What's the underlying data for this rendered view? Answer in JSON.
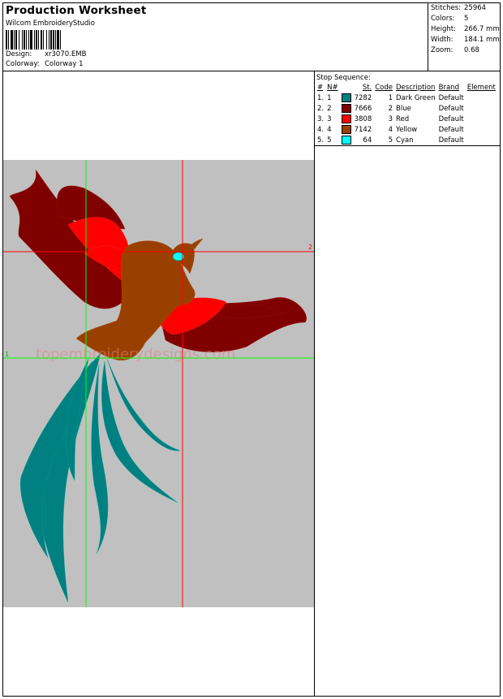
{
  "header": {
    "title": "Production Worksheet",
    "subtitle": "Wilcom EmbroideryStudio",
    "design_label": "Design:",
    "design_value": "xr3070.EMB",
    "colorway_label": "Colorway:",
    "colorway_value": "Colorway 1"
  },
  "stats": [
    {
      "label": "Stitches:",
      "value": "25964"
    },
    {
      "label": "Colors:",
      "value": "5"
    },
    {
      "label": "Height:",
      "value": "266.7 mm"
    },
    {
      "label": "Width:",
      "value": "184.1 mm"
    },
    {
      "label": "Zoom:",
      "value": "0.68"
    }
  ],
  "stop_sequence": {
    "title": "Stop Sequence:",
    "headers": {
      "num": "#",
      "needle": "N#",
      "st": "St.",
      "code": "Code",
      "description": "Description",
      "brand": "Brand",
      "element": "Element"
    },
    "rows": [
      {
        "num": "1.",
        "needle": "1",
        "color": "#008080",
        "st": "7282",
        "code": "1",
        "description": "Dark Green",
        "brand": "Default"
      },
      {
        "num": "2.",
        "needle": "2",
        "color": "#800000",
        "st": "7666",
        "code": "2",
        "description": "Blue",
        "brand": "Default"
      },
      {
        "num": "3.",
        "needle": "3",
        "color": "#ff0000",
        "st": "3808",
        "code": "3",
        "description": "Red",
        "brand": "Default"
      },
      {
        "num": "4.",
        "needle": "4",
        "color": "#994000",
        "st": "7142",
        "code": "4",
        "description": "Yellow",
        "brand": "Default"
      },
      {
        "num": "5.",
        "needle": "5",
        "color": "#00ffff",
        "st": "64",
        "code": "5",
        "description": "Cyan",
        "brand": "Default"
      }
    ]
  },
  "design": {
    "background": "#c0c0c0",
    "watermark": "topembroiderydesigns.com",
    "guide_green_label": "1",
    "guide_red_label": "2",
    "guide_green_color": "#00ff00",
    "guide_red_color": "#ff0000"
  }
}
